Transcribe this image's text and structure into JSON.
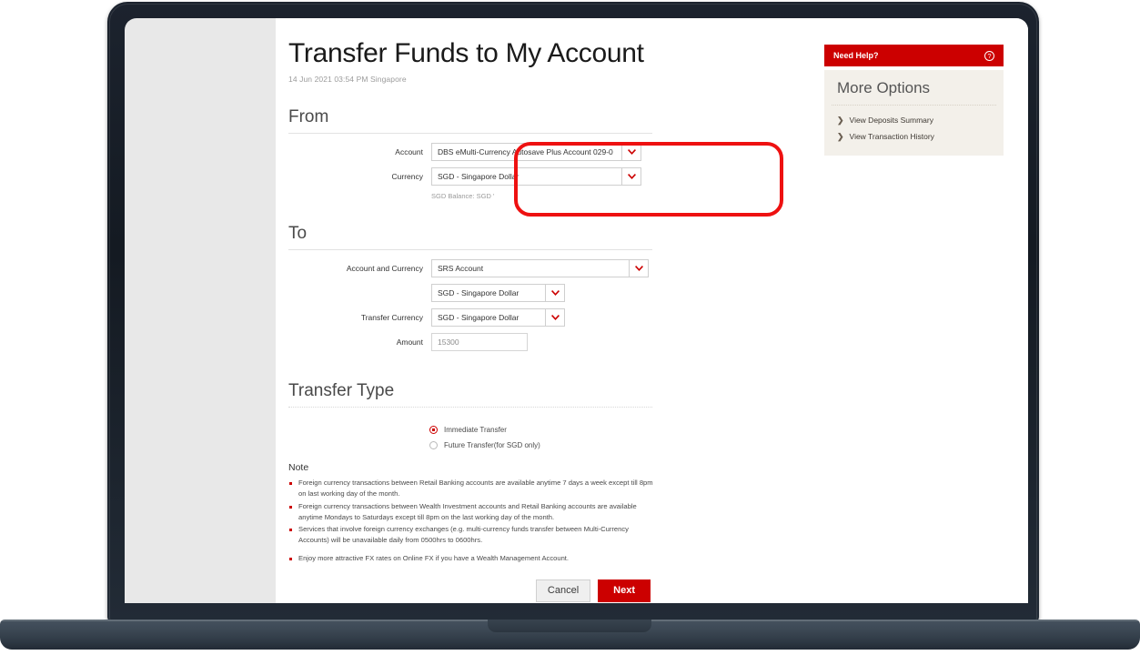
{
  "page": {
    "title": "Transfer Funds to My Account",
    "timestamp": "14 Jun 2021 03:54 PM Singapore"
  },
  "from_section": {
    "heading": "From",
    "account_label": "Account",
    "account_value": "DBS eMulti-Currency Autosave Plus Account 029-0",
    "currency_label": "Currency",
    "currency_value": "SGD - Singapore Dollar",
    "balance_note": "SGD Balance: SGD '"
  },
  "to_section": {
    "heading": "To",
    "account_currency_label": "Account and Currency",
    "account_value": "SRS Account",
    "account_currency_value": "SGD - Singapore Dollar",
    "transfer_currency_label": "Transfer Currency",
    "transfer_currency_value": "SGD - Singapore Dollar",
    "amount_label": "Amount",
    "amount_value": "15300"
  },
  "transfer_type": {
    "heading": "Transfer Type",
    "options": [
      {
        "label": "Immediate Transfer",
        "selected": true
      },
      {
        "label": "Future Transfer(for SGD only)",
        "selected": false
      }
    ]
  },
  "note": {
    "heading": "Note",
    "items": [
      "Foreign currency transactions between Retail Banking accounts are available anytime 7 days a week except till 8pm on last working day of the month.",
      "Foreign currency transactions between Wealth Investment accounts and Retail Banking accounts are available anytime Mondays to Saturdays except till 8pm on the last working day of the month.",
      "Services that involve foreign currency exchanges (e.g. multi-currency funds transfer between Multi-Currency Accounts) will be unavailable daily from 0500hrs to 0600hrs.",
      "Enjoy more attractive FX rates on Online FX if you have a Wealth Management Account."
    ]
  },
  "actions": {
    "cancel_label": "Cancel",
    "next_label": "Next"
  },
  "sidebar": {
    "help_title": "Need Help?",
    "help_icon": "question-mark-circle-icon",
    "more_options_title": "More Options",
    "links": [
      {
        "label": "View Deposits Summary"
      },
      {
        "label": "View Transaction History"
      }
    ]
  },
  "colors": {
    "brand_red": "#cc0000",
    "annotation_red": "#ee1111",
    "sidebar_bg": "#f3f0ea",
    "screen_bg": "#e8e8e8"
  }
}
